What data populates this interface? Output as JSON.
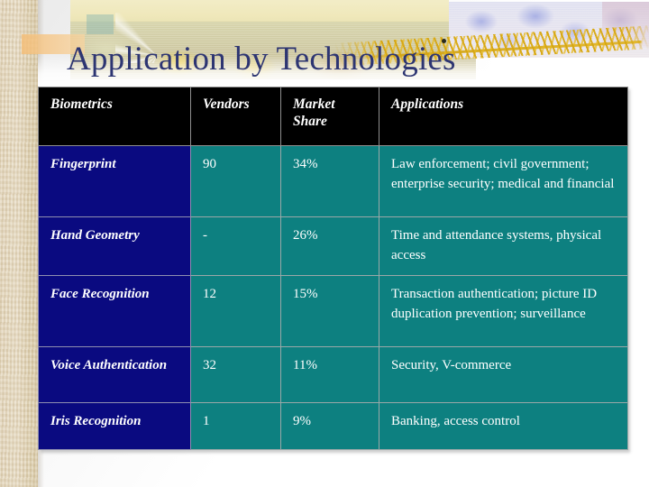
{
  "slide": {
    "title": "Application by Technologies",
    "title_color": "#2d3572",
    "theme": {
      "header_bg": "#000000",
      "category_bg": "#000080",
      "cell_bg": "#008080",
      "text_color": "#ffffff",
      "gridline_color": "#9aa8a8",
      "left_band_color": "#ded0b0"
    }
  },
  "table": {
    "columns": [
      {
        "label": "Biometrics",
        "key": "biometrics"
      },
      {
        "label": "Vendors",
        "key": "vendors"
      },
      {
        "label": "Market Share",
        "key": "market_share"
      },
      {
        "label": "Applications",
        "key": "applications"
      }
    ],
    "rows": [
      {
        "biometrics": "Fingerprint",
        "vendors": "90",
        "market_share": "34%",
        "applications": "Law enforcement; civil government; enterprise security; medical and financial"
      },
      {
        "biometrics": "Hand Geometry",
        "vendors": "-",
        "market_share": "26%",
        "applications": "Time and attendance systems, physical access"
      },
      {
        "biometrics": "Face Recognition",
        "vendors": "12",
        "market_share": "15%",
        "applications": "Transaction authentication; picture ID duplication prevention; surveillance"
      },
      {
        "biometrics": "Voice Authentication",
        "vendors": "32",
        "market_share": "11%",
        "applications": "Security, V-commerce"
      },
      {
        "biometrics": "Iris Recognition",
        "vendors": "1",
        "market_share": "9%",
        "applications": "Banking, access control"
      }
    ]
  },
  "chart_data": {
    "type": "table",
    "title": "Application by Technologies",
    "columns": [
      "Biometrics",
      "Vendors",
      "Market Share",
      "Applications"
    ],
    "categories": [
      "Fingerprint",
      "Hand Geometry",
      "Face Recognition",
      "Voice Authentication",
      "Iris Recognition"
    ],
    "series": [
      {
        "name": "Vendors",
        "values": [
          90,
          null,
          12,
          32,
          1
        ]
      },
      {
        "name": "Market Share (%)",
        "values": [
          34,
          26,
          15,
          11,
          9
        ]
      }
    ],
    "ylabel": "Market Share",
    "ylim": [
      0,
      100
    ]
  }
}
